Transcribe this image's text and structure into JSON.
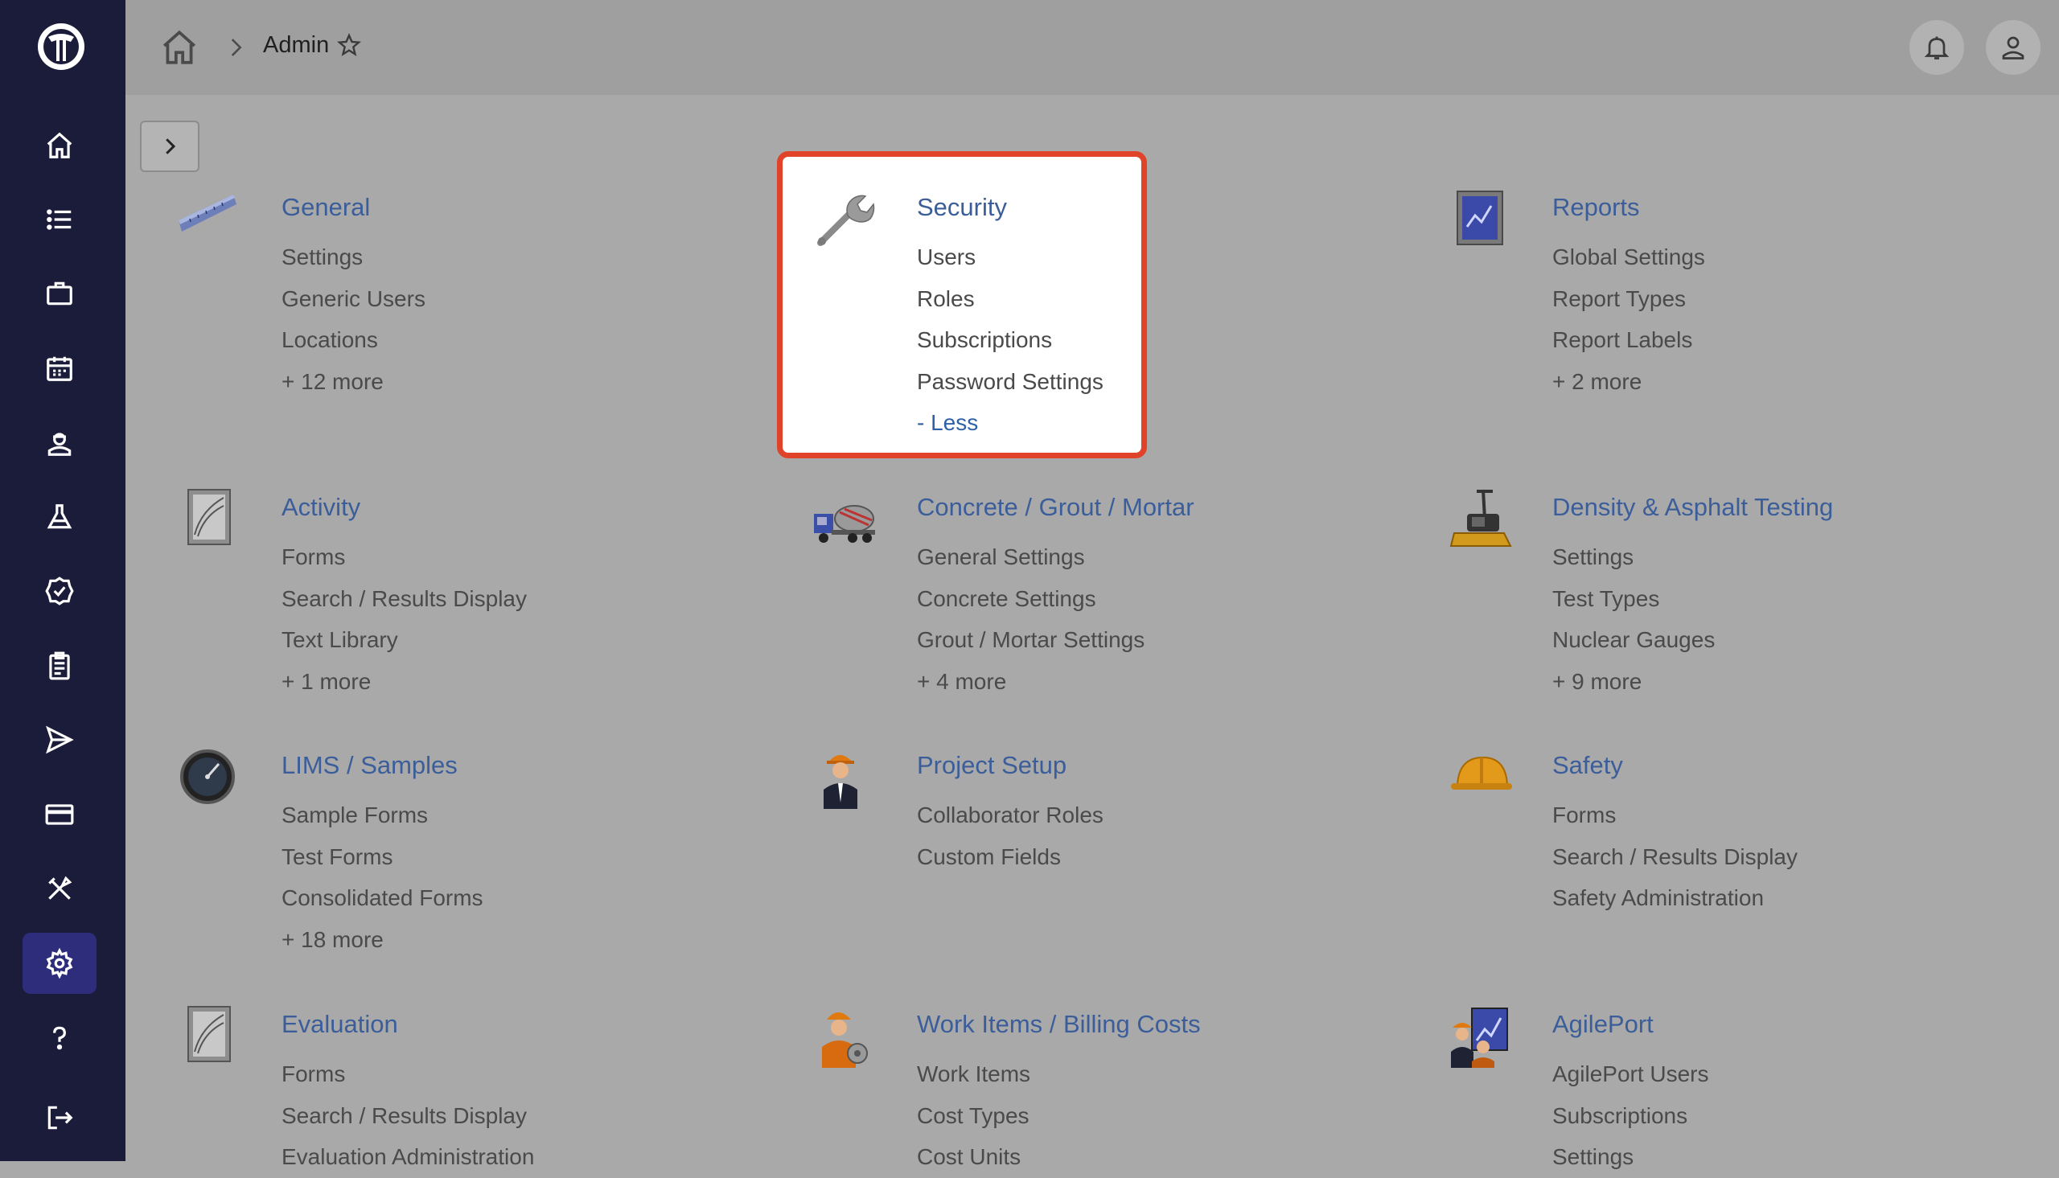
{
  "header": {
    "breadcrumb": "Admin"
  },
  "sidebar": {
    "items": [
      {
        "icon": "home-icon"
      },
      {
        "icon": "list-icon"
      },
      {
        "icon": "briefcase-icon"
      },
      {
        "icon": "calendar-icon"
      },
      {
        "icon": "technician-icon"
      },
      {
        "icon": "flask-icon"
      },
      {
        "icon": "badge-check-icon"
      },
      {
        "icon": "clipboard-icon"
      },
      {
        "icon": "send-icon"
      },
      {
        "icon": "credit-card-icon"
      },
      {
        "icon": "tools-icon"
      },
      {
        "icon": "gear-icon",
        "active": true
      },
      {
        "icon": "help-icon"
      },
      {
        "icon": "logout-icon"
      }
    ]
  },
  "colors": {
    "sidebar": "#1b1b3a",
    "active": "#2e2d7c",
    "link": "#3b5e9a",
    "highlight_border": "#e0432a"
  },
  "categories": [
    {
      "title": "General",
      "icon": "ruler-icon",
      "links": [
        "Settings",
        "Generic Users",
        "Locations",
        "+ 12 more"
      ]
    },
    {
      "title": "Security",
      "icon": "wrench-icon",
      "links": [
        "Users",
        "Roles",
        "Subscriptions",
        "Password Settings",
        "- Less"
      ]
    },
    {
      "title": "Reports",
      "icon": "report-icon",
      "links": [
        "Global Settings",
        "Report Types",
        "Report Labels",
        "+ 2 more"
      ]
    },
    {
      "title": "Activity",
      "icon": "activity-icon",
      "links": [
        "Forms",
        "Search / Results Display",
        "Text Library",
        "+ 1 more"
      ]
    },
    {
      "title": "Concrete / Grout / Mortar",
      "icon": "concrete-truck-icon",
      "links": [
        "General Settings",
        "Concrete Settings",
        "Grout / Mortar Settings",
        "+ 4 more"
      ]
    },
    {
      "title": "Density & Asphalt Testing",
      "icon": "compactor-icon",
      "links": [
        "Settings",
        "Test Types",
        "Nuclear Gauges",
        "+ 9 more"
      ]
    },
    {
      "title": "LIMS / Samples",
      "icon": "gauge-icon",
      "links": [
        "Sample Forms",
        "Test Forms",
        "Consolidated Forms",
        "+ 18 more"
      ]
    },
    {
      "title": "Project Setup",
      "icon": "project-manager-icon",
      "links": [
        "Collaborator Roles",
        "Custom Fields"
      ]
    },
    {
      "title": "Safety",
      "icon": "hard-hat-icon",
      "links": [
        "Forms",
        "Search / Results Display",
        "Safety Administration"
      ]
    },
    {
      "title": "Evaluation",
      "icon": "evaluation-icon",
      "links": [
        "Forms",
        "Search / Results Display",
        "Evaluation Administration"
      ]
    },
    {
      "title": "Work Items / Billing Costs",
      "icon": "worker-icon",
      "links": [
        "Work Items",
        "Cost Types",
        "Cost Units"
      ]
    },
    {
      "title": "AgilePort",
      "icon": "agileport-icon",
      "links": [
        "AgilePort Users",
        "Subscriptions",
        "Settings"
      ]
    }
  ]
}
